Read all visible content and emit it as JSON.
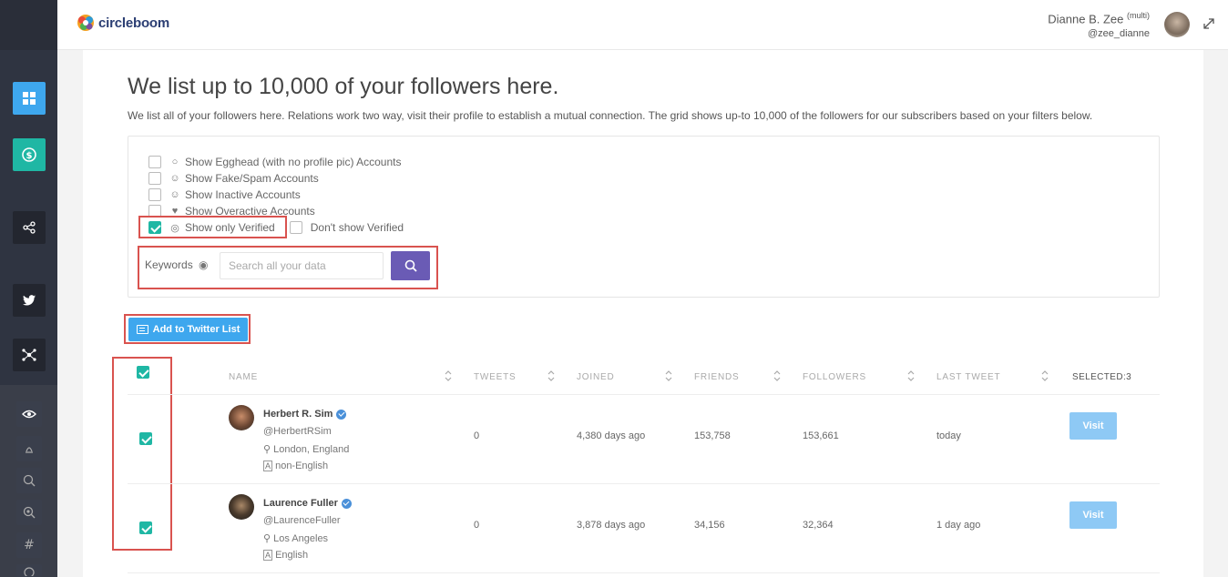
{
  "brand": {
    "name": "circleboom",
    "accent": "#1fb7a4",
    "primary_button": "#6a5bb5",
    "list_button": "#3ea7ee"
  },
  "user": {
    "name": "Dianne B. Zee",
    "mode": "(multi)",
    "handle": "@zee_dianne"
  },
  "sidebar": {
    "items": [
      {
        "icon": "dashboard-icon",
        "active": true
      },
      {
        "icon": "dollar-icon"
      },
      {
        "icon": "share-icon"
      },
      {
        "icon": "twitter-icon"
      },
      {
        "icon": "network-icon"
      },
      {
        "icon": "eye-icon"
      },
      {
        "icon": "egg-icon"
      },
      {
        "icon": "search-icon"
      },
      {
        "icon": "zoom-in-icon"
      },
      {
        "icon": "hashtag-icon"
      },
      {
        "icon": "history-icon"
      }
    ]
  },
  "page": {
    "title": "We list up to 10,000 of your followers here.",
    "description": "We list all of your followers here. Relations work two way, visit their profile to establish a mutual connection. The grid shows up-to 10,000 of the followers for our subscribers based on your filters below."
  },
  "filters": {
    "egghead": {
      "label": "Show Egghead (with no profile pic) Accounts",
      "checked": false
    },
    "fake": {
      "label": "Show Fake/Spam Accounts",
      "checked": false
    },
    "inactive": {
      "label": "Show Inactive Accounts",
      "checked": false
    },
    "overactive": {
      "label": "Show Overactive Accounts",
      "checked": false
    },
    "verified_only": {
      "label": "Show only Verified",
      "checked": true
    },
    "dont_show_verified": {
      "label": "Don't show Verified",
      "checked": false
    },
    "keywords_label": "Keywords",
    "search_placeholder": "Search all your data"
  },
  "actions": {
    "add_to_list": "Add to Twitter List"
  },
  "table": {
    "headers": {
      "name": "NAME",
      "tweets": "TWEETS",
      "joined": "JOINED",
      "friends": "FRIENDS",
      "followers": "FOLLOWERS",
      "last_tweet": "LAST TWEET",
      "selected": "SELECTED:3"
    },
    "rows": [
      {
        "name": "Herbert R. Sim",
        "handle": "@HerbertRSim",
        "location": "London, England",
        "language": "non-English",
        "tweets": "0",
        "joined": "4,380 days ago",
        "friends": "153,758",
        "followers": "153,661",
        "last_tweet": "today",
        "visit": "Visit",
        "checked": true
      },
      {
        "name": "Laurence Fuller",
        "handle": "@LaurenceFuller",
        "location": "Los Angeles",
        "language": "English",
        "tweets": "0",
        "joined": "3,878 days ago",
        "friends": "34,156",
        "followers": "32,364",
        "last_tweet": "1 day ago",
        "visit": "Visit",
        "checked": true
      }
    ]
  }
}
